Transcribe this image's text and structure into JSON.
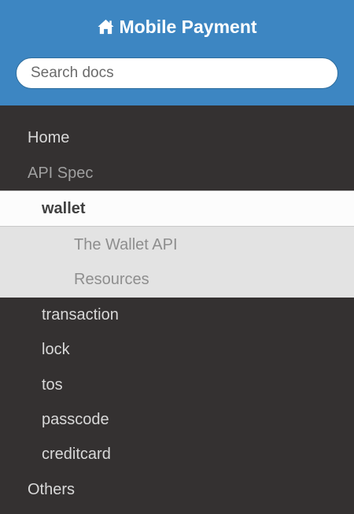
{
  "brand": {
    "title": "Mobile Payment",
    "icon": "home-icon"
  },
  "search": {
    "placeholder": "Search docs",
    "value": ""
  },
  "nav": {
    "home": "Home",
    "api_spec": "API Spec",
    "wallet": "wallet",
    "wallet_children": [
      "The Wallet API",
      "Resources"
    ],
    "transaction": "transaction",
    "lock": "lock",
    "tos": "tos",
    "passcode": "passcode",
    "creditcard": "creditcard",
    "others": "Others"
  },
  "colors": {
    "header": "#3d86c2",
    "sidebar": "#343131",
    "current_bg": "#fcfcfc",
    "sub_bg": "#e3e3e3"
  }
}
